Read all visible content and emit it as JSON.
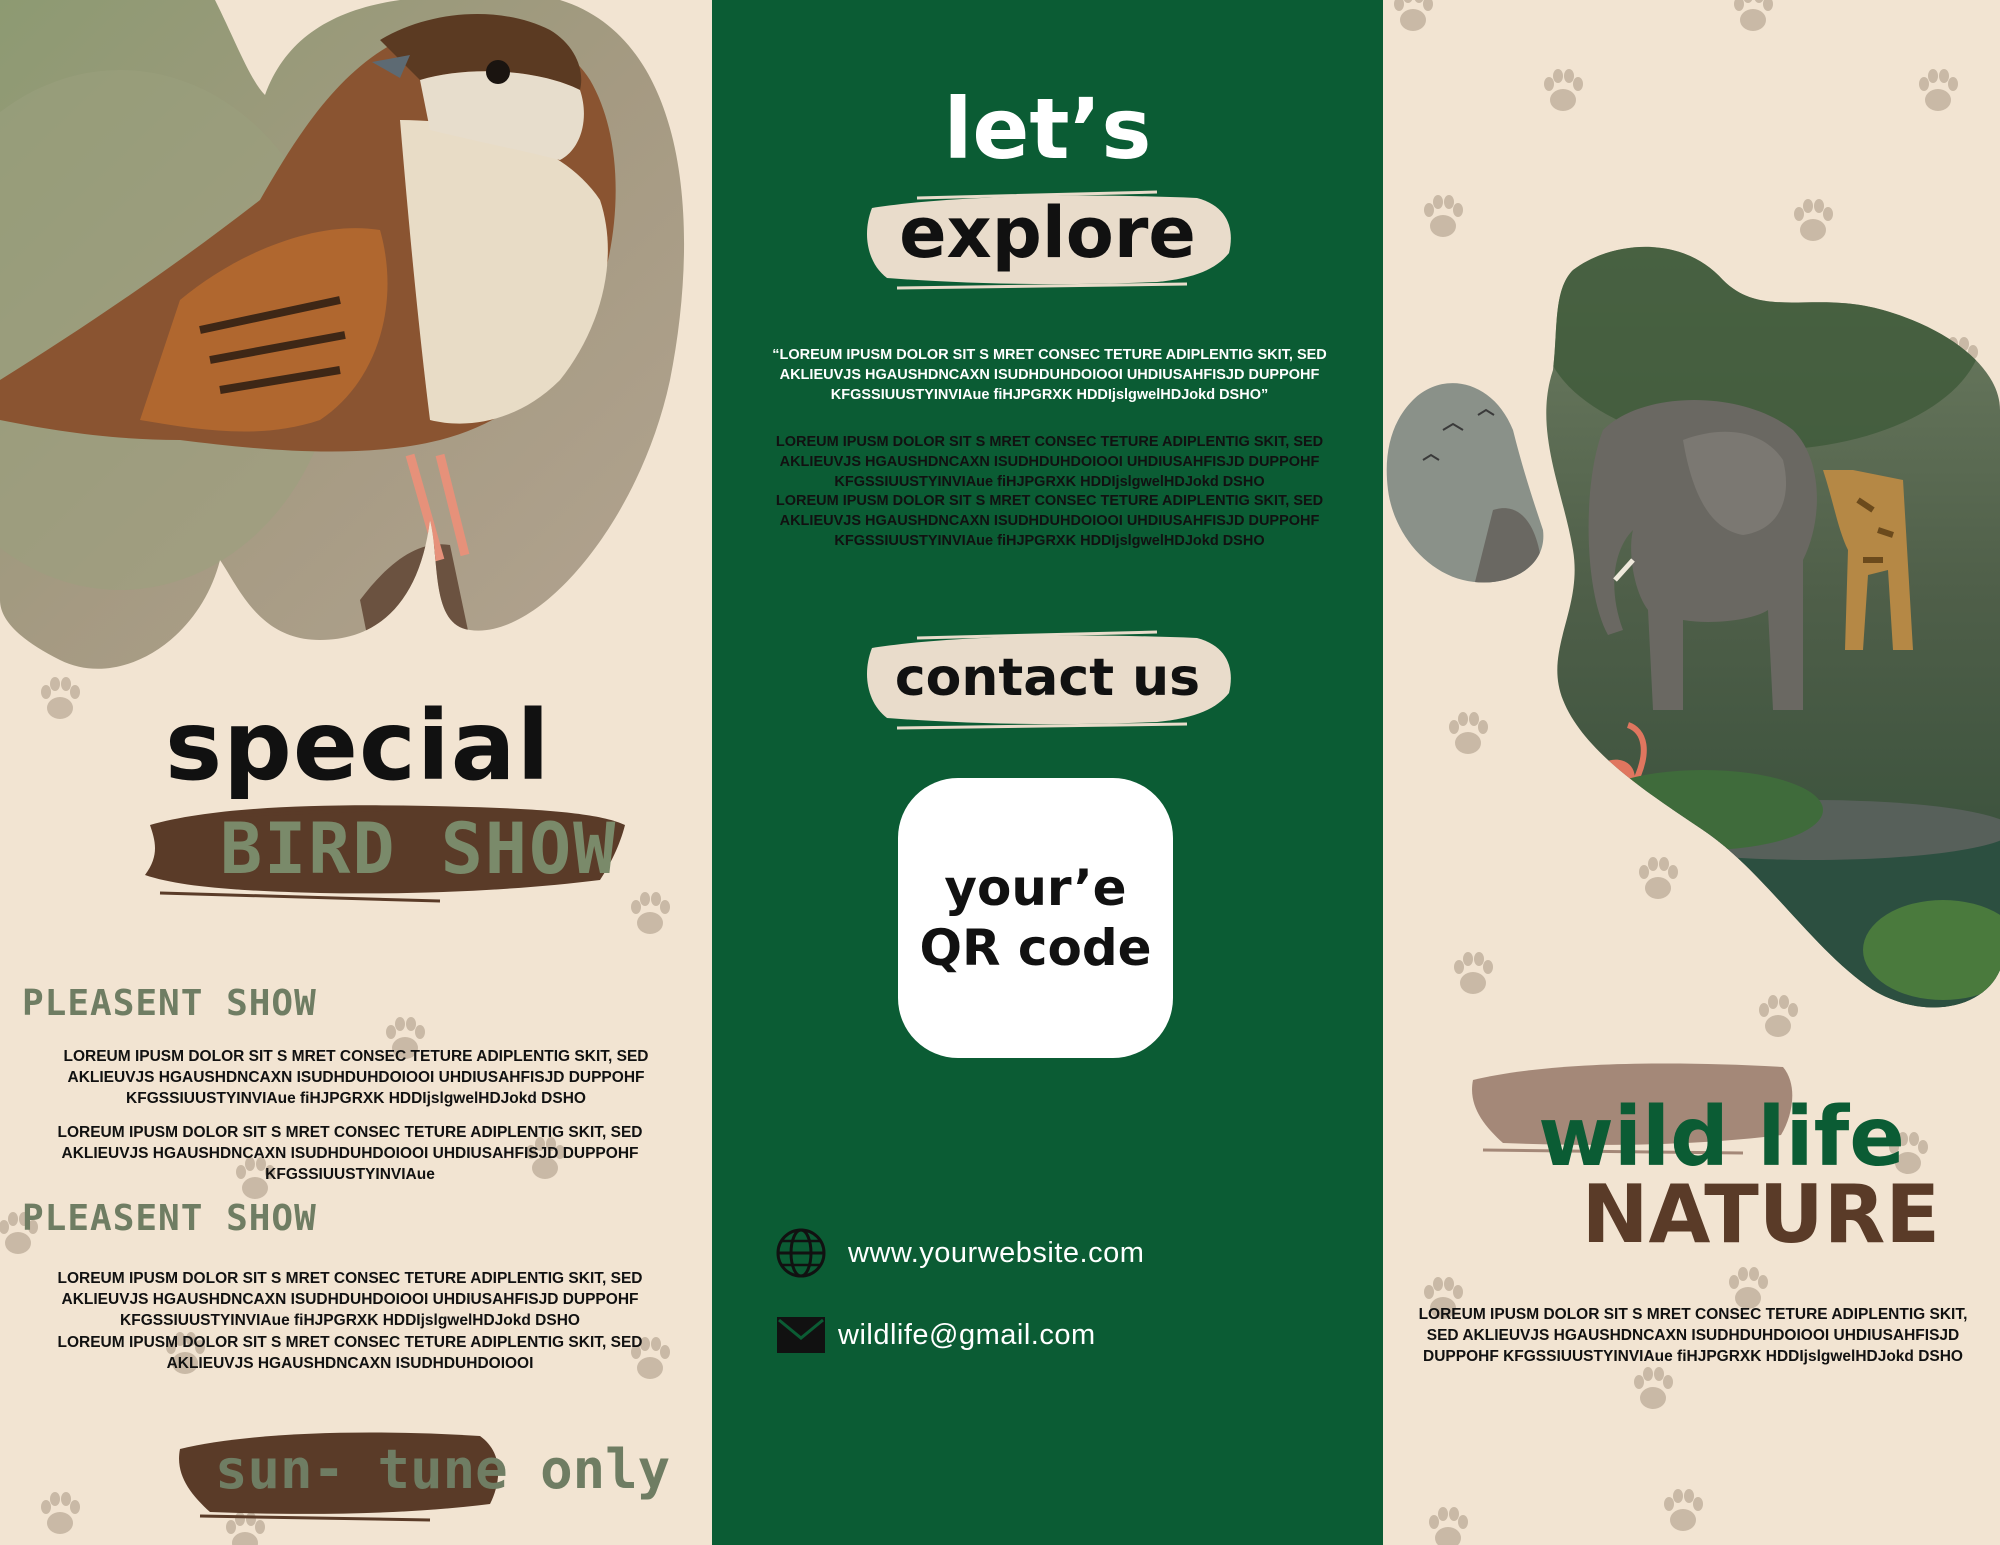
{
  "left": {
    "title_special": "special",
    "title_bird_show": "BIRD SHOW",
    "section1_heading": "PLEASENT SHOW",
    "section1_para1": "LOREUM IPUSM DOLOR SIT S MRET CONSEC TETURE ADIPLENTIG SKIT, SED AKLIEUVJS HGAUSHDNCAXN ISUDHDUHDOIOOI UHDIUSAHFISJD DUPPOHF KFGSSIUUSTYINVIAue fiHJPGRXK HDDIjslgwelHDJokd DSHO",
    "section1_para2": "LOREUM IPUSM DOLOR SIT S MRET CONSEC TETURE ADIPLENTIG SKIT, SED AKLIEUVJS HGAUSHDNCAXN ISUDHDUHDOIOOI UHDIUSAHFISJD DUPPOHF KFGSSIUUSTYINVIAue",
    "section2_heading": "PLEASENT SHOW",
    "section2_para1": "LOREUM IPUSM DOLOR SIT S MRET CONSEC TETURE ADIPLENTIG SKIT, SED AKLIEUVJS HGAUSHDNCAXN ISUDHDUHDOIOOI UHDIUSAHFISJD DUPPOHF KFGSSIUUSTYINVIAue fiHJPGRXK HDDIjslgwelHDJokd DSHO",
    "section2_para2": "LOREUM IPUSM DOLOR SIT S MRET CONSEC TETURE ADIPLENTIG SKIT, SED AKLIEUVJS HGAUSHDNCAXN ISUDHDUHDOIOOI",
    "footer_tag": "sun- tune only"
  },
  "middle": {
    "title_lets": "let’s",
    "title_explore": "explore",
    "quote_para": "“LOREUM IPUSM DOLOR SIT S MRET CONSEC TETURE ADIPLENTIG SKIT, SED AKLIEUVJS HGAUSHDNCAXN ISUDHDUHDOIOOI UHDIUSAHFISJD DUPPOHF KFGSSIUUSTYINVIAue fiHJPGRXK HDDIjslgwelHDJokd DSHO”",
    "para2": "LOREUM IPUSM DOLOR SIT S MRET CONSEC TETURE ADIPLENTIG SKIT, SED AKLIEUVJS HGAUSHDNCAXN ISUDHDUHDOIOOI UHDIUSAHFISJD DUPPOHF KFGSSIUUSTYINVIAue fiHJPGRXK HDDIjslgwelHDJokd DSHO",
    "para3": "LOREUM IPUSM DOLOR SIT S MRET CONSEC TETURE ADIPLENTIG SKIT, SED AKLIEUVJS HGAUSHDNCAXN ISUDHDUHDOIOOI UHDIUSAHFISJD DUPPOHF KFGSSIUUSTYINVIAue fiHJPGRXK HDDIjslgwelHDJokd DSHO",
    "contact_heading": "contact us",
    "qr_line1": "your’e",
    "qr_line2": "QR code",
    "website": "www.yourwebsite.com",
    "email": "wildlife@gmail.com"
  },
  "right": {
    "title_wild": "wild life",
    "title_nature": "NATURE",
    "para": "LOREUM IPUSM DOLOR SIT S MRET CONSEC TETURE ADIPLENTIG SKIT, SED AKLIEUVJS HGAUSHDNCAXN ISUDHDUHDOIOOI UHDIUSAHFISJD DUPPOHF KFGSSIUUSTYINVIAue fiHJPGRXK HDDIjslgwelHDJokd DSHO"
  },
  "colors": {
    "cream": "#f2e4d2",
    "forest_green": "#0b5c34",
    "brush_brown": "#5a3b28",
    "brush_tan": "#a48878",
    "sage": "#6f7d63",
    "paw": "#c9b9a6"
  },
  "icons": {
    "website": "globe-icon",
    "email": "envelope-icon",
    "pattern": "paw-print-icon"
  }
}
